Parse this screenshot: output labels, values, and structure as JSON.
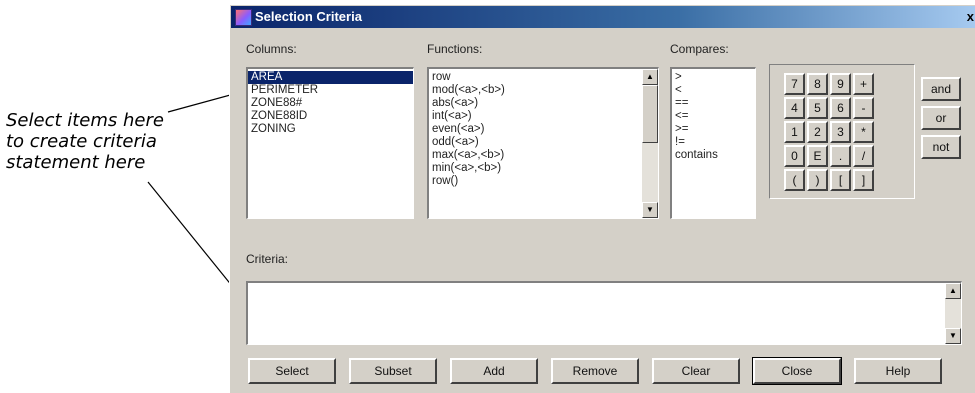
{
  "annotation": {
    "lines": [
      "Select items here",
      "to create criteria",
      "statement here"
    ]
  },
  "window": {
    "title": "Selection Criteria",
    "close_glyph": "x"
  },
  "columns": {
    "label": "Columns:",
    "items": [
      "AREA",
      "PERIMETER",
      "ZONE88#",
      "ZONE88ID",
      "ZONING"
    ],
    "selected": 0
  },
  "functions": {
    "label": "Functions:",
    "items": [
      "row",
      "mod(<a>,<b>)",
      "abs(<a>)",
      "int(<a>)",
      "even(<a>)",
      "odd(<a>)",
      "max(<a>,<b>)",
      "min(<a>,<b>)",
      "row()"
    ]
  },
  "compares": {
    "label": "Compares:",
    "items": [
      ">",
      "<",
      "==",
      "<=",
      ">=",
      "!=",
      "contains"
    ]
  },
  "keypad": {
    "rows": [
      [
        "7",
        "8",
        "9",
        "+"
      ],
      [
        "4",
        "5",
        "6",
        "-"
      ],
      [
        "1",
        "2",
        "3",
        "*"
      ],
      [
        "0",
        "E",
        ".",
        "/"
      ],
      [
        "(",
        ")",
        "[",
        "]"
      ]
    ]
  },
  "logic_buttons": [
    "and",
    "or",
    "not"
  ],
  "criteria": {
    "label": "Criteria:",
    "value": ""
  },
  "bottom_buttons": [
    "Select",
    "Subset",
    "Add",
    "Remove",
    "Clear",
    "Close",
    "Help"
  ],
  "icons": {
    "scroll_up": "scroll-up-icon",
    "scroll_down": "scroll-down-icon",
    "app": "app-icon"
  }
}
